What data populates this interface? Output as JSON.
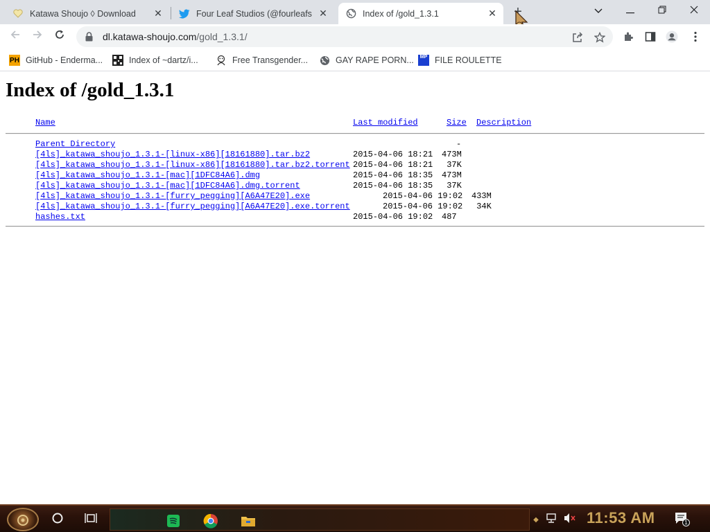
{
  "browser": {
    "tabs": [
      {
        "title": "Katawa Shoujo ◊ Download",
        "icon": "heart-icon"
      },
      {
        "title": "Four Leaf Studios (@fourleafs",
        "icon": "twitter-bird-icon"
      },
      {
        "title": "Index of /gold_1.3.1",
        "icon": "globe-icon",
        "active": true
      }
    ],
    "new_tab_label": "+",
    "url_host": "dl.katawa-shoujo.com",
    "url_path": "/gold_1.3.1/",
    "bookmarks": [
      {
        "label": "GitHub - Enderma...",
        "icon": "ph-icon"
      },
      {
        "label": "Index of ~dartz/i...",
        "icon": "qr-icon"
      },
      {
        "label": "Free Transgender...",
        "icon": "mascot-icon"
      },
      {
        "label": "GAY RAPE PORN...",
        "icon": "globe-icon"
      },
      {
        "label": "FILE ROULETTE",
        "icon": "file-icon"
      }
    ],
    "ph_badge": "PH",
    "file_badge": "MP"
  },
  "page": {
    "heading": "Index of /gold_1.3.1",
    "columns": {
      "name": "Name",
      "modified": "Last modified",
      "size": "Size",
      "description": "Description"
    },
    "parent": {
      "name": "Parent Directory",
      "size": "-"
    },
    "files": [
      {
        "name": "[4ls]_katawa_shoujo_1.3.1-[linux-x86][18161880].tar.bz2",
        "modified": "2015-04-06 18:21",
        "size": "473M"
      },
      {
        "name": "[4ls]_katawa_shoujo_1.3.1-[linux-x86][18161880].tar.bz2.torrent",
        "modified": "2015-04-06 18:21",
        "size": " 37K"
      },
      {
        "name": "[4ls]_katawa_shoujo_1.3.1-[mac][1DFC84A6].dmg",
        "modified": "2015-04-06 18:35",
        "size": "473M"
      },
      {
        "name": "[4ls]_katawa_shoujo_1.3.1-[mac][1DFC84A6].dmg.torrent",
        "modified": "2015-04-06 18:35",
        "size": " 37K"
      },
      {
        "name": "[4ls]_katawa_shoujo_1.3.1-[furry_pegging][A6A47E20].exe",
        "modified": "2015-04-06 19:02",
        "size": "433M",
        "shifted": true
      },
      {
        "name": "[4ls]_katawa_shoujo_1.3.1-[furry_pegging][A6A47E20].exe.torrent",
        "modified": "2015-04-06 19:02",
        "size": " 34K",
        "shifted": true
      },
      {
        "name": "hashes.txt",
        "modified": "2015-04-06 19:02",
        "size": "487"
      }
    ]
  },
  "taskbar": {
    "clock": "11:53 AM",
    "notification_count": "1",
    "apps": [
      "task-view-icon",
      "spotify-icon",
      "chrome-icon",
      "file-explorer-icon"
    ]
  },
  "colors": {
    "link": "#0000ee",
    "clock": "#c9a35a",
    "twitter": "#1d9bf0"
  }
}
